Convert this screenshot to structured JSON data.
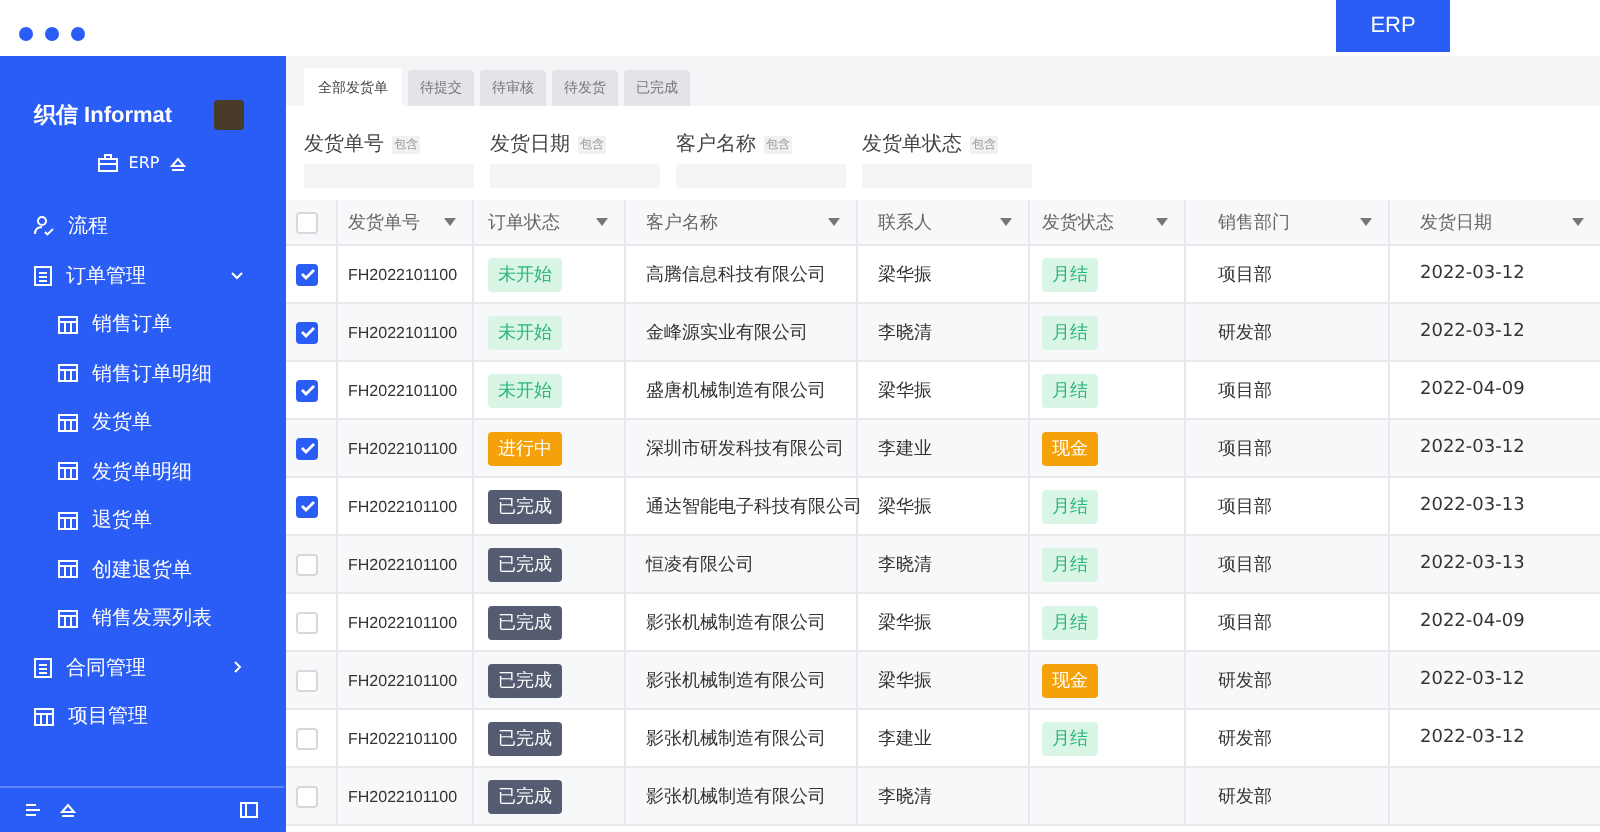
{
  "top_bar": {
    "badge": "ERP"
  },
  "sidebar": {
    "brand": "织信 Informat",
    "app": "ERP",
    "items": [
      {
        "label": "流程",
        "kind": "flow"
      },
      {
        "label": "订单管理",
        "kind": "group",
        "expanded": true,
        "children": [
          {
            "label": "销售订单"
          },
          {
            "label": "销售订单明细"
          },
          {
            "label": "发货单"
          },
          {
            "label": "发货单明细"
          },
          {
            "label": "退货单"
          },
          {
            "label": "创建退货单"
          },
          {
            "label": "销售发票列表"
          }
        ]
      },
      {
        "label": "合同管理",
        "kind": "group",
        "expanded": false
      },
      {
        "label": "项目管理",
        "kind": "page"
      }
    ]
  },
  "tabs": [
    {
      "label": "全部发货单",
      "selected": true
    },
    {
      "label": "待提交",
      "selected": false
    },
    {
      "label": "待审核",
      "selected": false
    },
    {
      "label": "待发货",
      "selected": false
    },
    {
      "label": "已完成",
      "selected": false
    }
  ],
  "filters": [
    {
      "label": "发货单号",
      "hint": "包含"
    },
    {
      "label": "发货日期",
      "hint": "包含"
    },
    {
      "label": "客户名称",
      "hint": "包含"
    },
    {
      "label": "发货单状态",
      "hint": "包含"
    }
  ],
  "table": {
    "all_checked": false,
    "columns": [
      "发货单号",
      "订单状态",
      "客户名称",
      "联系人",
      "发货状态",
      "销售部门",
      "发货日期"
    ],
    "rows": [
      {
        "checked": true,
        "number": "FH2022101100",
        "order_status": {
          "text": "未开始",
          "kind": "pending"
        },
        "customer": "高腾信息科技有限公司",
        "contact": "梁华振",
        "ship_status": {
          "text": "月结",
          "kind": "monthly"
        },
        "department": "项目部",
        "date": "2022-03-12"
      },
      {
        "checked": true,
        "number": "FH2022101100",
        "order_status": {
          "text": "未开始",
          "kind": "pending"
        },
        "customer": "金峰源实业有限公司",
        "contact": "李晓清",
        "ship_status": {
          "text": "月结",
          "kind": "monthly"
        },
        "department": "研发部",
        "date": "2022-03-12"
      },
      {
        "checked": true,
        "number": "FH2022101100",
        "order_status": {
          "text": "未开始",
          "kind": "pending"
        },
        "customer": "盛唐机械制造有限公司",
        "contact": "梁华振",
        "ship_status": {
          "text": "月结",
          "kind": "monthly"
        },
        "department": "项目部",
        "date": "2022-04-09"
      },
      {
        "checked": true,
        "number": "FH2022101100",
        "order_status": {
          "text": "进行中",
          "kind": "active"
        },
        "customer": "深圳市研发科技有限公司",
        "contact": "李建业",
        "ship_status": {
          "text": "现金",
          "kind": "cash"
        },
        "department": "项目部",
        "date": "2022-03-12"
      },
      {
        "checked": true,
        "number": "FH2022101100",
        "order_status": {
          "text": "已完成",
          "kind": "done"
        },
        "customer": "通达智能电子科技有限公司",
        "contact": "梁华振",
        "ship_status": {
          "text": "月结",
          "kind": "monthly"
        },
        "department": "项目部",
        "date": "2022-03-13"
      },
      {
        "checked": false,
        "number": "FH2022101100",
        "order_status": {
          "text": "已完成",
          "kind": "done"
        },
        "customer": "恒凌有限公司",
        "contact": "李晓清",
        "ship_status": {
          "text": "月结",
          "kind": "monthly"
        },
        "department": "项目部",
        "date": "2022-03-13"
      },
      {
        "checked": false,
        "number": "FH2022101100",
        "order_status": {
          "text": "已完成",
          "kind": "done"
        },
        "customer": "影张机械制造有限公司",
        "contact": "梁华振",
        "ship_status": {
          "text": "月结",
          "kind": "monthly"
        },
        "department": "项目部",
        "date": "2022-04-09"
      },
      {
        "checked": false,
        "number": "FH2022101100",
        "order_status": {
          "text": "已完成",
          "kind": "done"
        },
        "customer": "影张机械制造有限公司",
        "contact": "梁华振",
        "ship_status": {
          "text": "现金",
          "kind": "cash"
        },
        "department": "研发部",
        "date": "2022-03-12"
      },
      {
        "checked": false,
        "number": "FH2022101100",
        "order_status": {
          "text": "已完成",
          "kind": "done"
        },
        "customer": "影张机械制造有限公司",
        "contact": "李建业",
        "ship_status": {
          "text": "月结",
          "kind": "monthly"
        },
        "department": "研发部",
        "date": "2022-03-12"
      },
      {
        "checked": false,
        "number": "FH2022101100",
        "order_status": {
          "text": "已完成",
          "kind": "done"
        },
        "customer": "影张机械制造有限公司",
        "contact": "李晓清",
        "department": "研发部"
      }
    ]
  }
}
